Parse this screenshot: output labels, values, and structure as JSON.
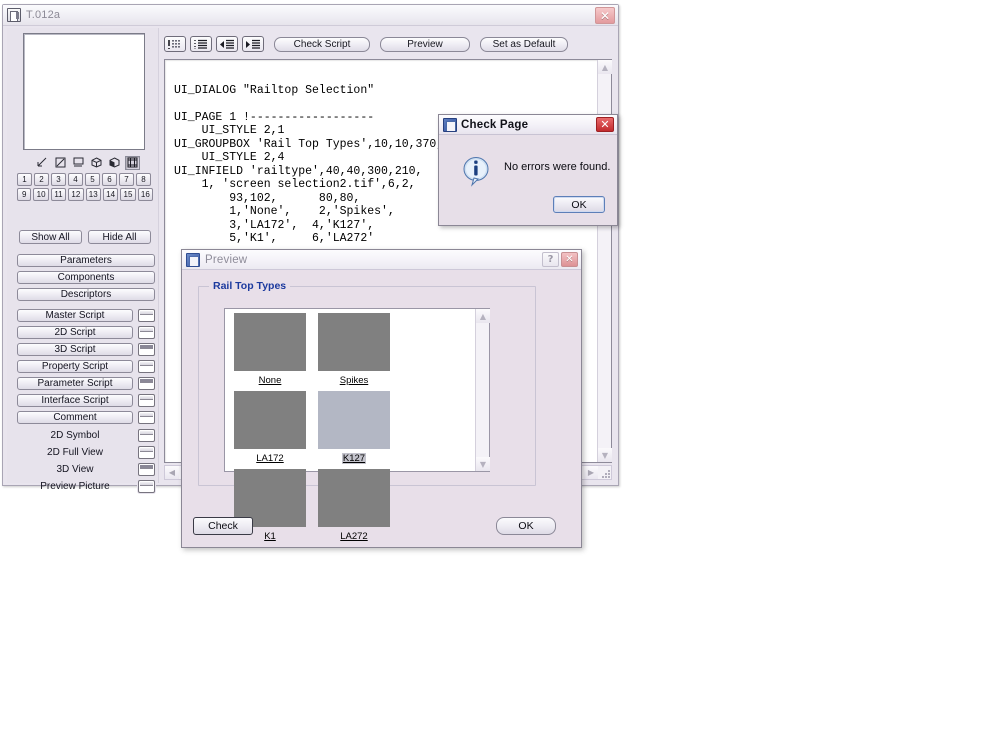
{
  "main_window": {
    "title": "T.012a",
    "icon": "document-app-icon",
    "close_label": "✕"
  },
  "sidebar": {
    "view_icons": [
      {
        "name": "edit-line-icon"
      },
      {
        "name": "2d-symbol-icon"
      },
      {
        "name": "2d-full-view-icon"
      },
      {
        "name": "3d-wireframe-cube-icon"
      },
      {
        "name": "3d-solid-cube-icon"
      },
      {
        "name": "preview-picture-icon",
        "pressed": true
      }
    ],
    "page_numbers_row1": [
      "1",
      "2",
      "3",
      "4",
      "5",
      "6",
      "7",
      "8"
    ],
    "page_numbers_row2": [
      "9",
      "10",
      "11",
      "12",
      "13",
      "14",
      "15",
      "16"
    ],
    "show_all_label": "Show All",
    "hide_all_label": "Hide All",
    "main_buttons": [
      "Parameters",
      "Components",
      "Descriptors"
    ],
    "script_buttons": [
      {
        "label": "Master Script",
        "has_button": true,
        "icon_dark": false
      },
      {
        "label": "2D Script",
        "has_button": true,
        "icon_dark": false
      },
      {
        "label": "3D Script",
        "has_button": true,
        "icon_dark": true
      },
      {
        "label": "Property Script",
        "has_button": true,
        "icon_dark": false
      },
      {
        "label": "Parameter Script",
        "has_button": true,
        "icon_dark": true
      },
      {
        "label": "Interface Script",
        "has_button": true,
        "icon_dark": false
      },
      {
        "label": "Comment",
        "has_button": true,
        "icon_dark": false
      }
    ],
    "view_rows": [
      {
        "label": "2D Symbol",
        "icon_dark": false
      },
      {
        "label": "2D Full View",
        "icon_dark": false
      },
      {
        "label": "3D View",
        "icon_dark": true
      },
      {
        "label": "Preview Picture",
        "icon_dark": false
      }
    ]
  },
  "toolbar": {
    "icons": [
      {
        "name": "show-all-comments-icon"
      },
      {
        "name": "format-lines-icon"
      },
      {
        "name": "increase-indent-icon"
      },
      {
        "name": "decrease-indent-icon"
      }
    ],
    "check_script_label": "Check Script",
    "preview_label": "Preview",
    "set_as_default_label": "Set as Default"
  },
  "editor": {
    "script": "UI_DIALOG \"Railtop Selection\"\n\nUI_PAGE 1 !------------------\n    UI_STYLE 2,1\nUI_GROUPBOX 'Rail Top Types',10,10,370,255\n    UI_STYLE 2,4\nUI_INFIELD 'railtype',40,40,300,210,\n    1, 'screen selection2.tif',6,2,\n        93,102,      80,80,\n        1,'None',    2,'Spikes',\n        3,'LA172',  4,'K127',\n        5,'K1',     6,'LA272'",
    "scroll_up": "▲",
    "scroll_down": "▼",
    "scroll_left": "◀",
    "scroll_right": "▶"
  },
  "check_page_dialog": {
    "title": "Check Page",
    "icon": "check-page-icon",
    "close_label": "✕",
    "message": "No errors were found.",
    "ok_label": "OK",
    "info_icon": "info-icon"
  },
  "preview_dialog": {
    "title": "Preview",
    "icon": "preview-window-icon",
    "help_label": "?",
    "close_label": "✕",
    "groupbox_label": "Rail Top Types",
    "thumbnails": [
      {
        "label": "None",
        "selected": false,
        "color": "#808080"
      },
      {
        "label": "Spikes",
        "selected": false,
        "color": "#808080"
      },
      {
        "label": "LA172",
        "selected": false,
        "color": "#808080"
      },
      {
        "label": "K127",
        "selected": true,
        "color": "#b3b7c4"
      },
      {
        "label": "K1",
        "selected": false,
        "color": "#808080"
      },
      {
        "label": "LA272",
        "selected": false,
        "color": "#808080"
      }
    ],
    "check_label": "Check",
    "ok_label": "OK",
    "scroll_up": "▲",
    "scroll_down": "▼"
  },
  "colors": {
    "window_bg": "#e9e5ee",
    "dialog_bg": "#e8dfe9",
    "groupbox_label": "#1c3a9e",
    "thumb_gray": "#808080",
    "thumb_selected": "#b3b7c4",
    "close_red": "#c22b2e"
  }
}
